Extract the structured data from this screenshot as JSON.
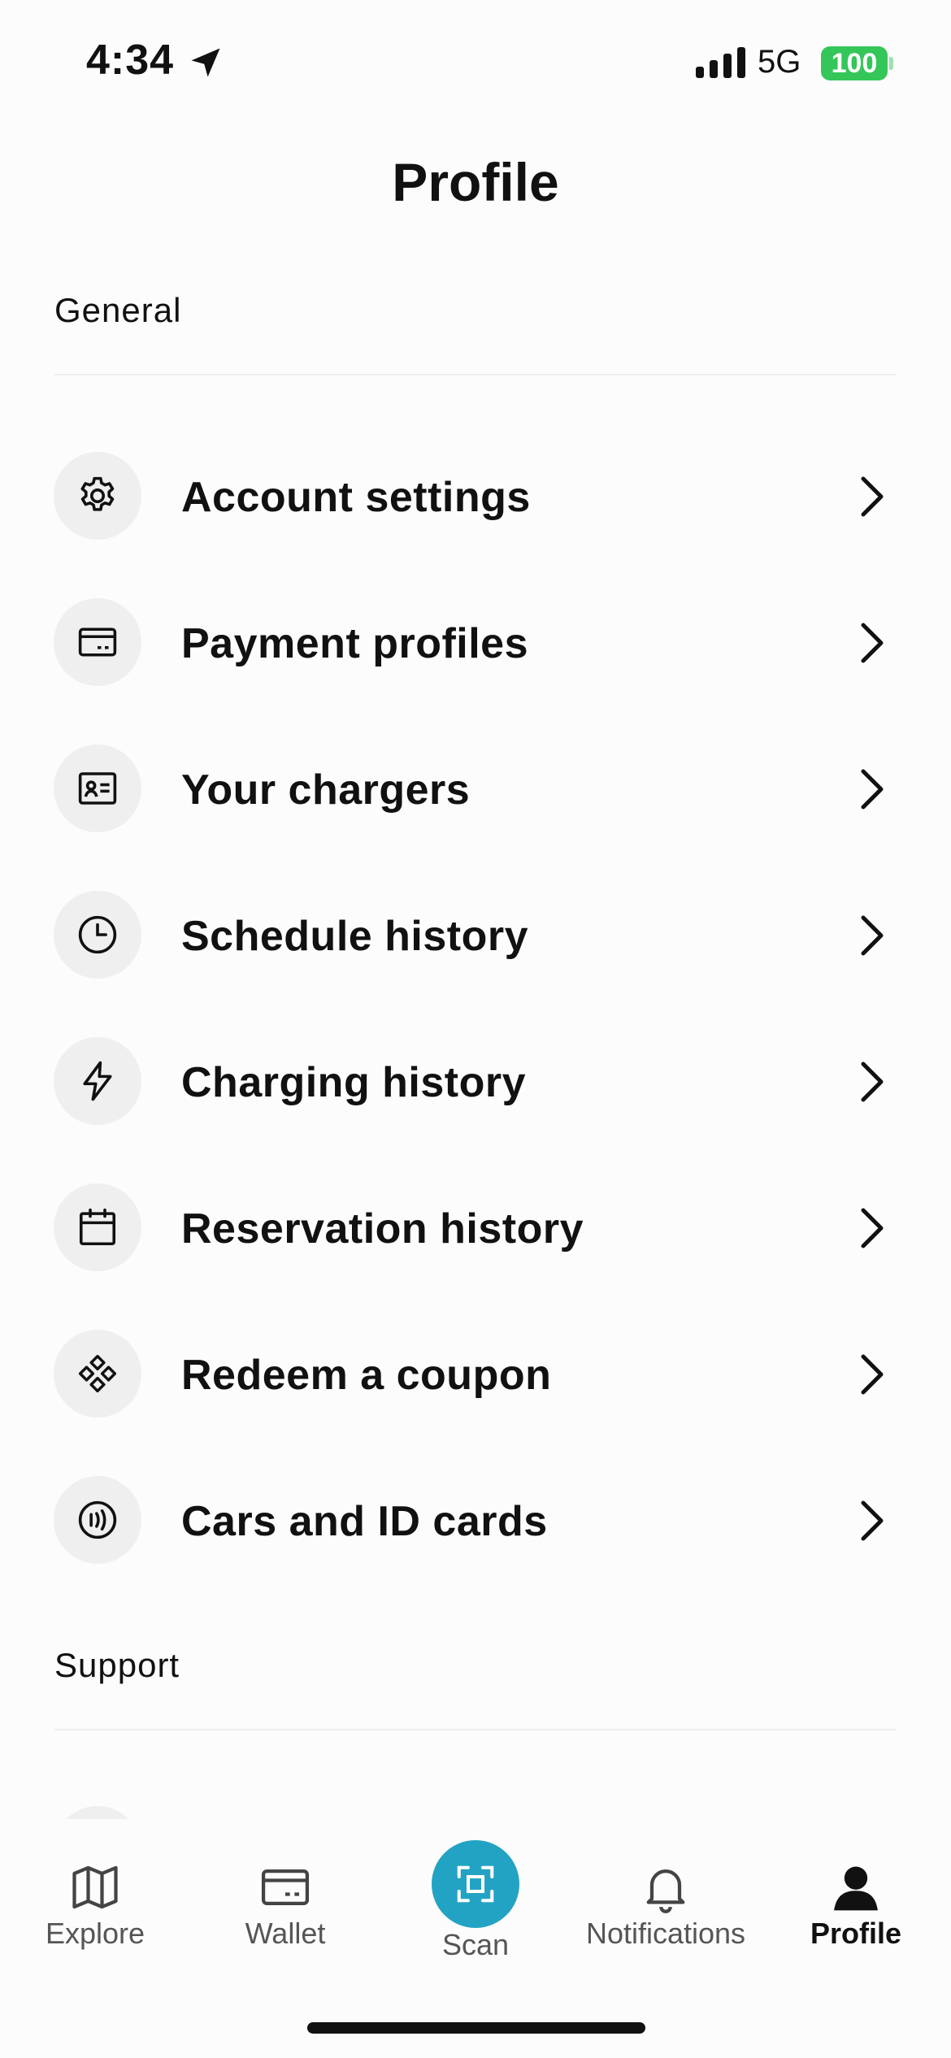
{
  "status_bar": {
    "time": "4:34",
    "network": "5G",
    "battery": "100",
    "battery_color": "#35c659"
  },
  "header": {
    "title": "Profile"
  },
  "sections": {
    "general": {
      "label": "General"
    },
    "support": {
      "label": "Support"
    }
  },
  "menu": {
    "items": [
      {
        "label": "Account settings",
        "icon": "gear-icon"
      },
      {
        "label": "Payment profiles",
        "icon": "credit-card-icon"
      },
      {
        "label": "Your chargers",
        "icon": "id-card-icon"
      },
      {
        "label": "Schedule history",
        "icon": "clock-icon"
      },
      {
        "label": "Charging history",
        "icon": "lightning-icon"
      },
      {
        "label": "Reservation history",
        "icon": "calendar-icon"
      },
      {
        "label": "Redeem a coupon",
        "icon": "coupon-icon"
      },
      {
        "label": "Cars and ID cards",
        "icon": "rfid-card-icon"
      }
    ]
  },
  "tab_bar": {
    "accent_color": "#23a3c3",
    "tabs": [
      {
        "label": "Explore",
        "icon": "map-icon",
        "active": false
      },
      {
        "label": "Wallet",
        "icon": "wallet-icon",
        "active": false
      },
      {
        "label": "Scan",
        "icon": "scan-icon",
        "active": false
      },
      {
        "label": "Notifications",
        "icon": "bell-icon",
        "active": false
      },
      {
        "label": "Profile",
        "icon": "person-icon",
        "active": true
      }
    ]
  }
}
